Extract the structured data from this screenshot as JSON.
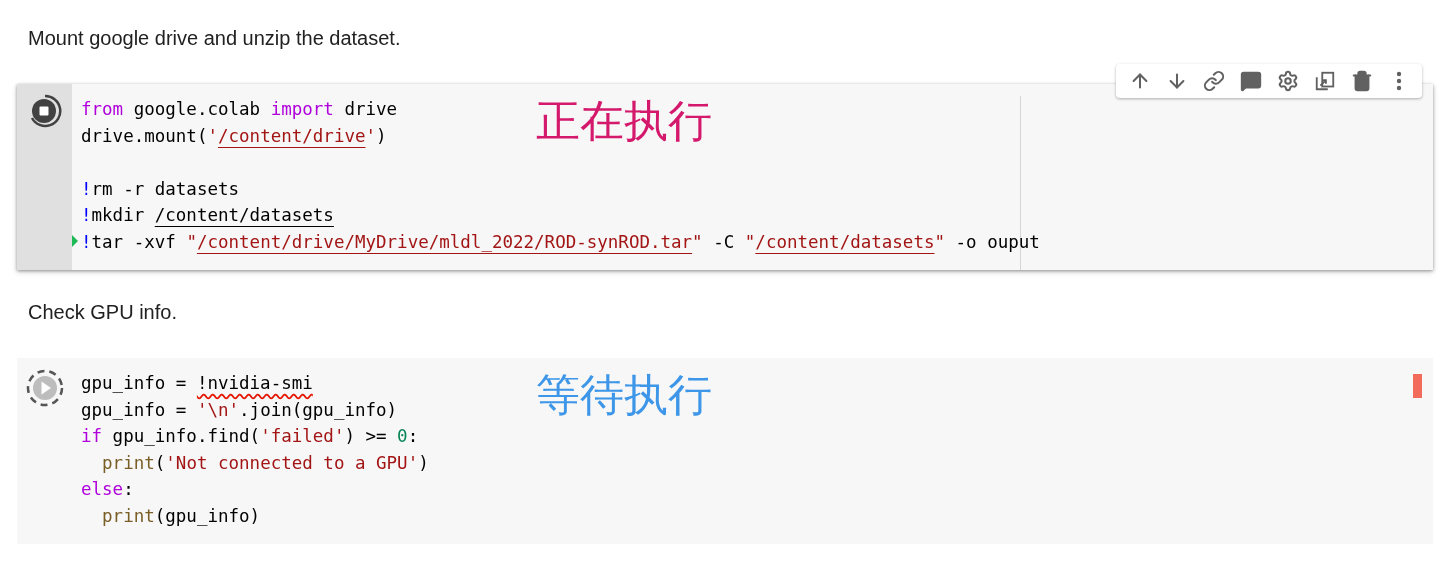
{
  "blocks": [
    {
      "kind": "text",
      "text": "Mount google drive and unzip the dataset."
    },
    {
      "kind": "code",
      "running": true,
      "focused": true,
      "flagged": false,
      "annotation": {
        "text": "正在执行",
        "color": "#d4186c"
      },
      "lines": [
        {
          "current": false,
          "tokens": [
            {
              "kind": "keyword",
              "text": "from"
            },
            {
              "kind": "plain",
              "text": " google.colab "
            },
            {
              "kind": "keyword",
              "text": "import"
            },
            {
              "kind": "plain",
              "text": " drive"
            }
          ]
        },
        {
          "current": false,
          "tokens": [
            {
              "kind": "plain",
              "text": "drive.mount("
            },
            {
              "kind": "string",
              "text": "'"
            },
            {
              "kind": "string",
              "text": "/content/drive",
              "underlined": true
            },
            {
              "kind": "string",
              "text": "'"
            },
            {
              "kind": "plain",
              "text": ")"
            }
          ]
        },
        {
          "current": false,
          "gap_before": true,
          "tokens": [
            {
              "kind": "bang",
              "text": "!"
            },
            {
              "kind": "plain",
              "text": "rm -r datasets"
            }
          ]
        },
        {
          "current": false,
          "tokens": [
            {
              "kind": "bang",
              "text": "!"
            },
            {
              "kind": "plain",
              "text": "mkdir "
            },
            {
              "kind": "plain",
              "text": "/content/datasets",
              "underlined": true
            }
          ]
        },
        {
          "current": true,
          "tokens": [
            {
              "kind": "bang",
              "text": "!"
            },
            {
              "kind": "plain",
              "text": "tar -xvf "
            },
            {
              "kind": "string",
              "text": "\""
            },
            {
              "kind": "string",
              "text": "/content/drive/MyDrive/mldl_2022/ROD-synROD.tar",
              "underlined": true
            },
            {
              "kind": "string",
              "text": "\""
            },
            {
              "kind": "plain",
              "text": " -C "
            },
            {
              "kind": "string",
              "text": "\""
            },
            {
              "kind": "string",
              "text": "/content/datasets",
              "underlined": true
            },
            {
              "kind": "string",
              "text": "\""
            },
            {
              "kind": "plain",
              "text": " -o ouput"
            }
          ]
        }
      ]
    },
    {
      "kind": "text",
      "text": "Check GPU info."
    },
    {
      "kind": "code",
      "running": false,
      "focused": false,
      "flagged": true,
      "annotation": {
        "text": "等待执行",
        "color": "#3d96e8"
      },
      "lines": [
        {
          "current": false,
          "tokens": [
            {
              "kind": "plain",
              "text": "gpu_info = "
            },
            {
              "kind": "plain",
              "text": "!nvidia-smi",
              "spelling_error": true
            }
          ]
        },
        {
          "current": false,
          "tokens": [
            {
              "kind": "plain",
              "text": "gpu_info = "
            },
            {
              "kind": "string",
              "text": "'\\n'"
            },
            {
              "kind": "plain",
              "text": ".join(gpu_info)"
            }
          ]
        },
        {
          "current": false,
          "tokens": [
            {
              "kind": "keyword",
              "text": "if"
            },
            {
              "kind": "plain",
              "text": " gpu_info.find("
            },
            {
              "kind": "string",
              "text": "'failed'"
            },
            {
              "kind": "plain",
              "text": ") >= "
            },
            {
              "kind": "number",
              "text": "0"
            },
            {
              "kind": "plain",
              "text": ":"
            }
          ]
        },
        {
          "current": false,
          "tokens": [
            {
              "kind": "func",
              "text": "  print"
            },
            {
              "kind": "plain",
              "text": "("
            },
            {
              "kind": "string",
              "text": "'Not connected to a GPU'"
            },
            {
              "kind": "plain",
              "text": ")"
            }
          ]
        },
        {
          "current": false,
          "tokens": [
            {
              "kind": "keyword",
              "text": "else"
            },
            {
              "kind": "plain",
              "text": ":"
            }
          ]
        },
        {
          "current": false,
          "tokens": [
            {
              "kind": "func",
              "text": "  print"
            },
            {
              "kind": "plain",
              "text": "(gpu_info)"
            }
          ]
        }
      ]
    }
  ]
}
